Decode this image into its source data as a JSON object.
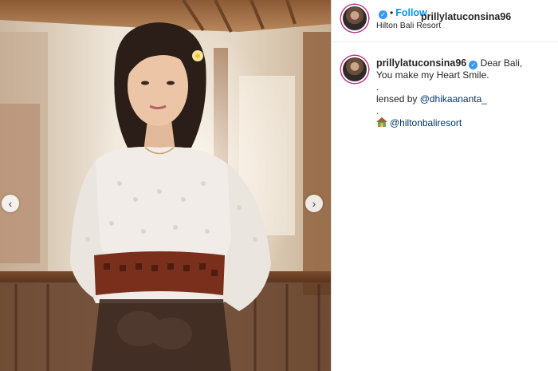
{
  "post": {
    "username": "prillylatuconsina96",
    "follow_label": "Follow",
    "location": "Hilton Bali Resort",
    "caption": {
      "line1": "Dear Bali,",
      "line2": "You make my Heart Smile.",
      "dot1": ".",
      "lensed_prefix": "lensed by ",
      "lensed_mention": "@dhikaananta_",
      "dot2": ".",
      "resort_mention": "@hiltonbaliresort"
    }
  },
  "carousel": {
    "prev_icon": "chevron-left-icon",
    "next_icon": "chevron-right-icon"
  },
  "colors": {
    "accent": "#0095f6",
    "mention": "#00376b",
    "verified": "#3897f0"
  }
}
